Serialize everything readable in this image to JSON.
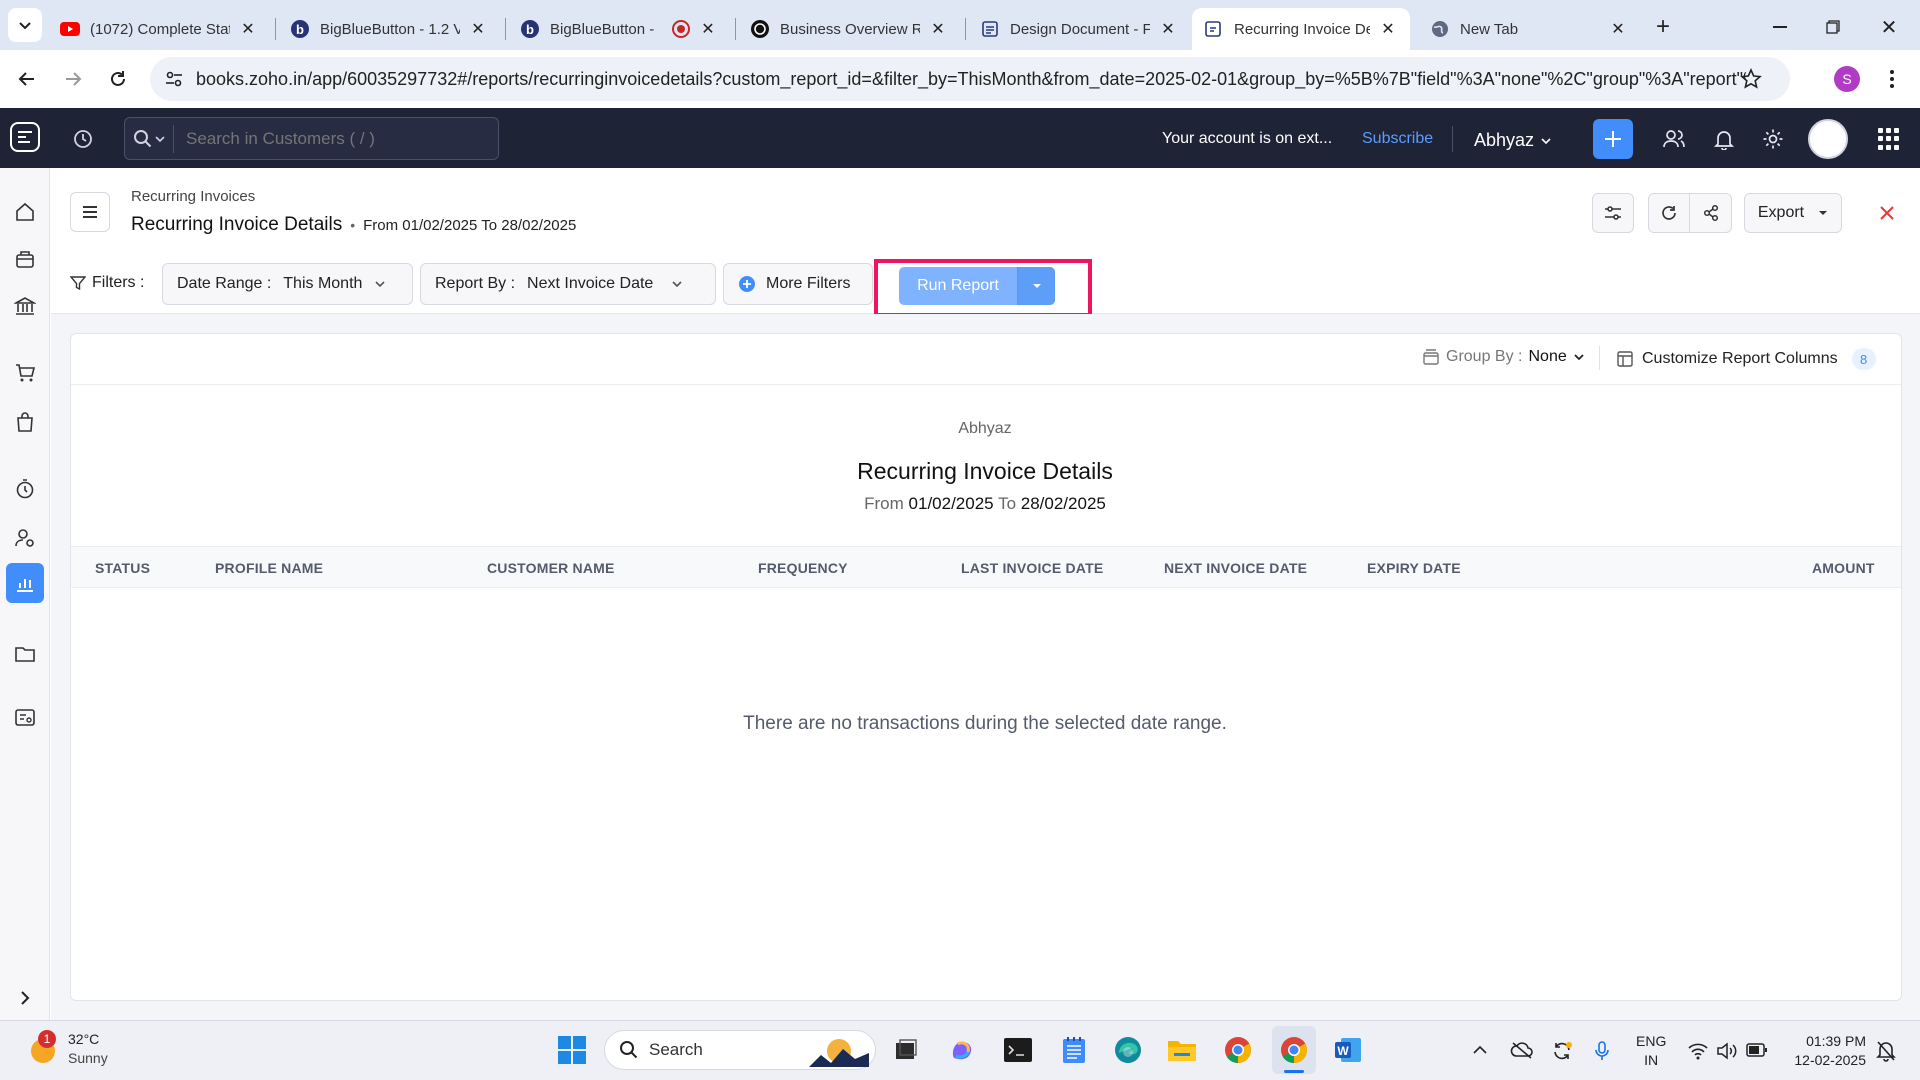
{
  "browser": {
    "tabs": [
      {
        "title": "(1072) Complete Stat",
        "icon": "youtube-icon"
      },
      {
        "title": "BigBlueButton - 1.2 V",
        "icon": "bigbluebutton-icon"
      },
      {
        "title": "BigBlueButton - ",
        "icon": "bigbluebutton-icon"
      },
      {
        "title": "Business Overview Re",
        "icon": "openai-icon"
      },
      {
        "title": "Design Document - F",
        "icon": "document-icon"
      },
      {
        "title": "Recurring Invoice De",
        "icon": "zoho-books-icon"
      },
      {
        "title": "New Tab",
        "icon": "globe-icon"
      }
    ],
    "url": "books.zoho.in/app/60035297732#/reports/recurringinvoicedetails?custom_report_id=&filter_by=ThisMonth&from_date=2025-02-01&group_by=%5B%7B\"field\"%3A\"none\"%2C\"group\"%3A\"report\"%7...",
    "profile_initial": "S",
    "profile_color": "#b23bc5"
  },
  "topnav": {
    "search_placeholder": "Search in Customers ( / )",
    "account_notice": "Your account is on ext...",
    "subscribe": "Subscribe",
    "org_name": "Abhyaz",
    "accent": "#408dfb"
  },
  "header": {
    "breadcrumb": "Recurring Invoices",
    "title": "Recurring Invoice Details",
    "separator": "•",
    "date_range": "From 01/02/2025 To 28/02/2025",
    "export_label": "Export"
  },
  "filters": {
    "label": "Filters :",
    "date_range_label": "Date Range :",
    "date_range_value": "This Month",
    "report_by_label": "Report By :",
    "report_by_value": "Next Invoice Date",
    "more_filters": "More Filters",
    "run_report": "Run Report",
    "highlight_color": "#f0135e"
  },
  "report": {
    "group_by_label": "Group By :",
    "group_by_value": "None",
    "customize_label": "Customize Report Columns",
    "customize_count": "8",
    "org": "Abhyaz",
    "title": "Recurring Invoice Details",
    "from_label": "From",
    "from_date": "01/02/2025",
    "to_label": "To",
    "to_date": "28/02/2025",
    "columns": [
      "STATUS",
      "PROFILE NAME",
      "CUSTOMER NAME",
      "FREQUENCY",
      "LAST INVOICE DATE",
      "NEXT INVOICE DATE",
      "EXPIRY DATE",
      "AMOUNT"
    ],
    "empty_message": "There are no transactions during the selected date range."
  },
  "taskbar": {
    "weather_temp": "32°C",
    "weather_desc": "Sunny",
    "weather_badge": "1",
    "search_label": "Search",
    "lang": "ENG",
    "region": "IN",
    "time": "01:39 PM",
    "date": "12-02-2025"
  }
}
